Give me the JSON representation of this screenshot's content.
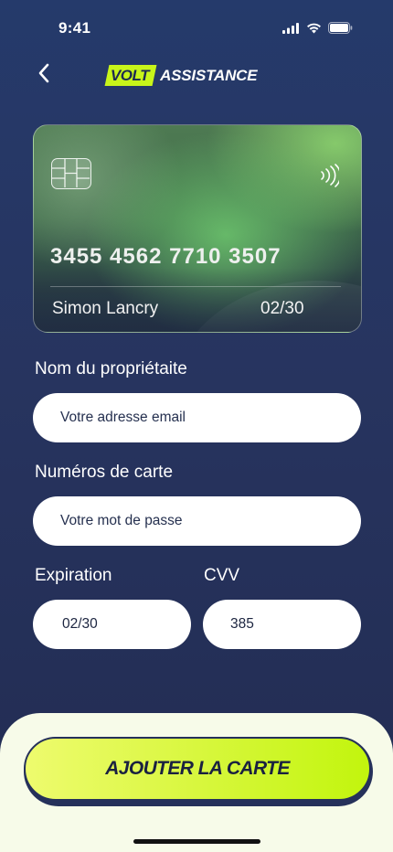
{
  "status_bar": {
    "time": "9:41",
    "icons": [
      "cellular-signal-icon",
      "wifi-icon",
      "battery-icon"
    ]
  },
  "header": {
    "back_icon": "chevron-left-icon",
    "logo_badge": "VOLT",
    "logo_text": "ASSISTANCE"
  },
  "card": {
    "chip_icon": "card-chip-icon",
    "contactless_icon": "contactless-icon",
    "number": "3455 4562 7710 3507",
    "holder": "Simon Lancry",
    "expiry": "02/30"
  },
  "form": {
    "owner_label": "Nom du propriétaite",
    "owner_placeholder": "Votre adresse email",
    "number_label": "Numéros de carte",
    "number_placeholder": "Votre mot de passe",
    "expiration_label": "Expiration",
    "expiration_value": "02/30",
    "cvv_label": "CVV",
    "cvv_value": "385"
  },
  "cta": {
    "label": "AJOUTER LA CARTE"
  },
  "colors": {
    "background": "#263661",
    "accent": "#c8f51a",
    "sheet": "#f7fbe9",
    "navy": "#26315a"
  }
}
